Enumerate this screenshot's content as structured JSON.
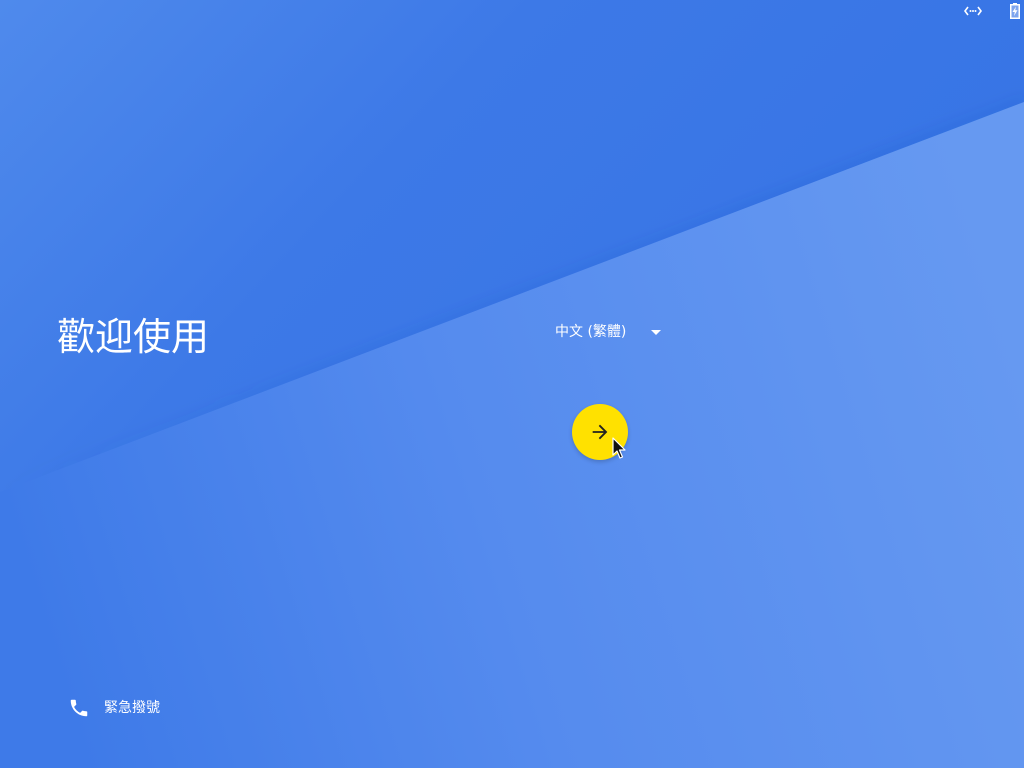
{
  "status_bar": {
    "network_icon": "ethernet-icon",
    "battery_icon": "battery-charging-icon"
  },
  "welcome": {
    "title": "歡迎使用"
  },
  "language": {
    "selected": "中文 (繁體)",
    "icon": "dropdown-arrow-icon"
  },
  "start_button": {
    "icon": "arrow-right-icon"
  },
  "emergency": {
    "label": "緊急撥號",
    "icon": "phone-icon"
  },
  "cursor": {
    "icon": "mouse-pointer-icon"
  },
  "colors": {
    "background_top": "#3a77e6",
    "background_bottom": "#5d91ef",
    "start_button": "#ffe100",
    "start_button_icon": "#212121",
    "text": "#ffffff"
  }
}
